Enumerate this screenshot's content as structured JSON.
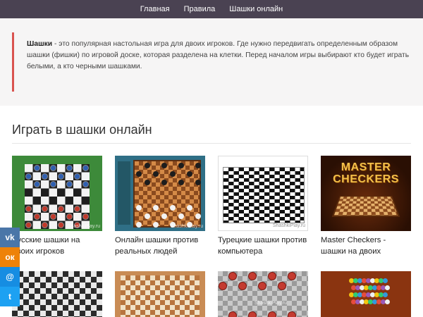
{
  "nav": {
    "items": [
      {
        "label": "Главная"
      },
      {
        "label": "Правила"
      },
      {
        "label": "Шашки онлайн"
      }
    ]
  },
  "intro": {
    "term": "Шашки",
    "text": " - это популярная настольная игра для двоих игроков. Где нужно передвигать определенным образом шашки (фишки) по игровой доске, которая разделена на клетки. Перед началом игры выбирают кто будет играть белыми, а кто черными шашками."
  },
  "games": {
    "title": "Играть в шашки онлайн",
    "cards": [
      {
        "title": "Русские шашки на двоих игроков",
        "watermark": "ShashkiPlay.ru"
      },
      {
        "title": "Онлайн шашки против реальных людей",
        "watermark": "ShashkiPlay.ru"
      },
      {
        "title": "Турецкие шашки против компьютера",
        "watermark": "ShashkiPlay.ru"
      },
      {
        "title": "Master Checkers - шашки на двоих",
        "logo_line1": "MASTER",
        "logo_line2": "CHECKERS"
      }
    ],
    "row2_watermark": "ShashkiPlay.ru"
  },
  "social": [
    {
      "icon": "vk-icon",
      "glyph": "vk",
      "color": "#4a76a8"
    },
    {
      "icon": "odnoklassniki-icon",
      "glyph": "ок",
      "color": "#ee8208"
    },
    {
      "icon": "mail-icon",
      "glyph": "@",
      "color": "#168de2"
    },
    {
      "icon": "twitter-icon",
      "glyph": "t",
      "color": "#1da1f2"
    }
  ]
}
